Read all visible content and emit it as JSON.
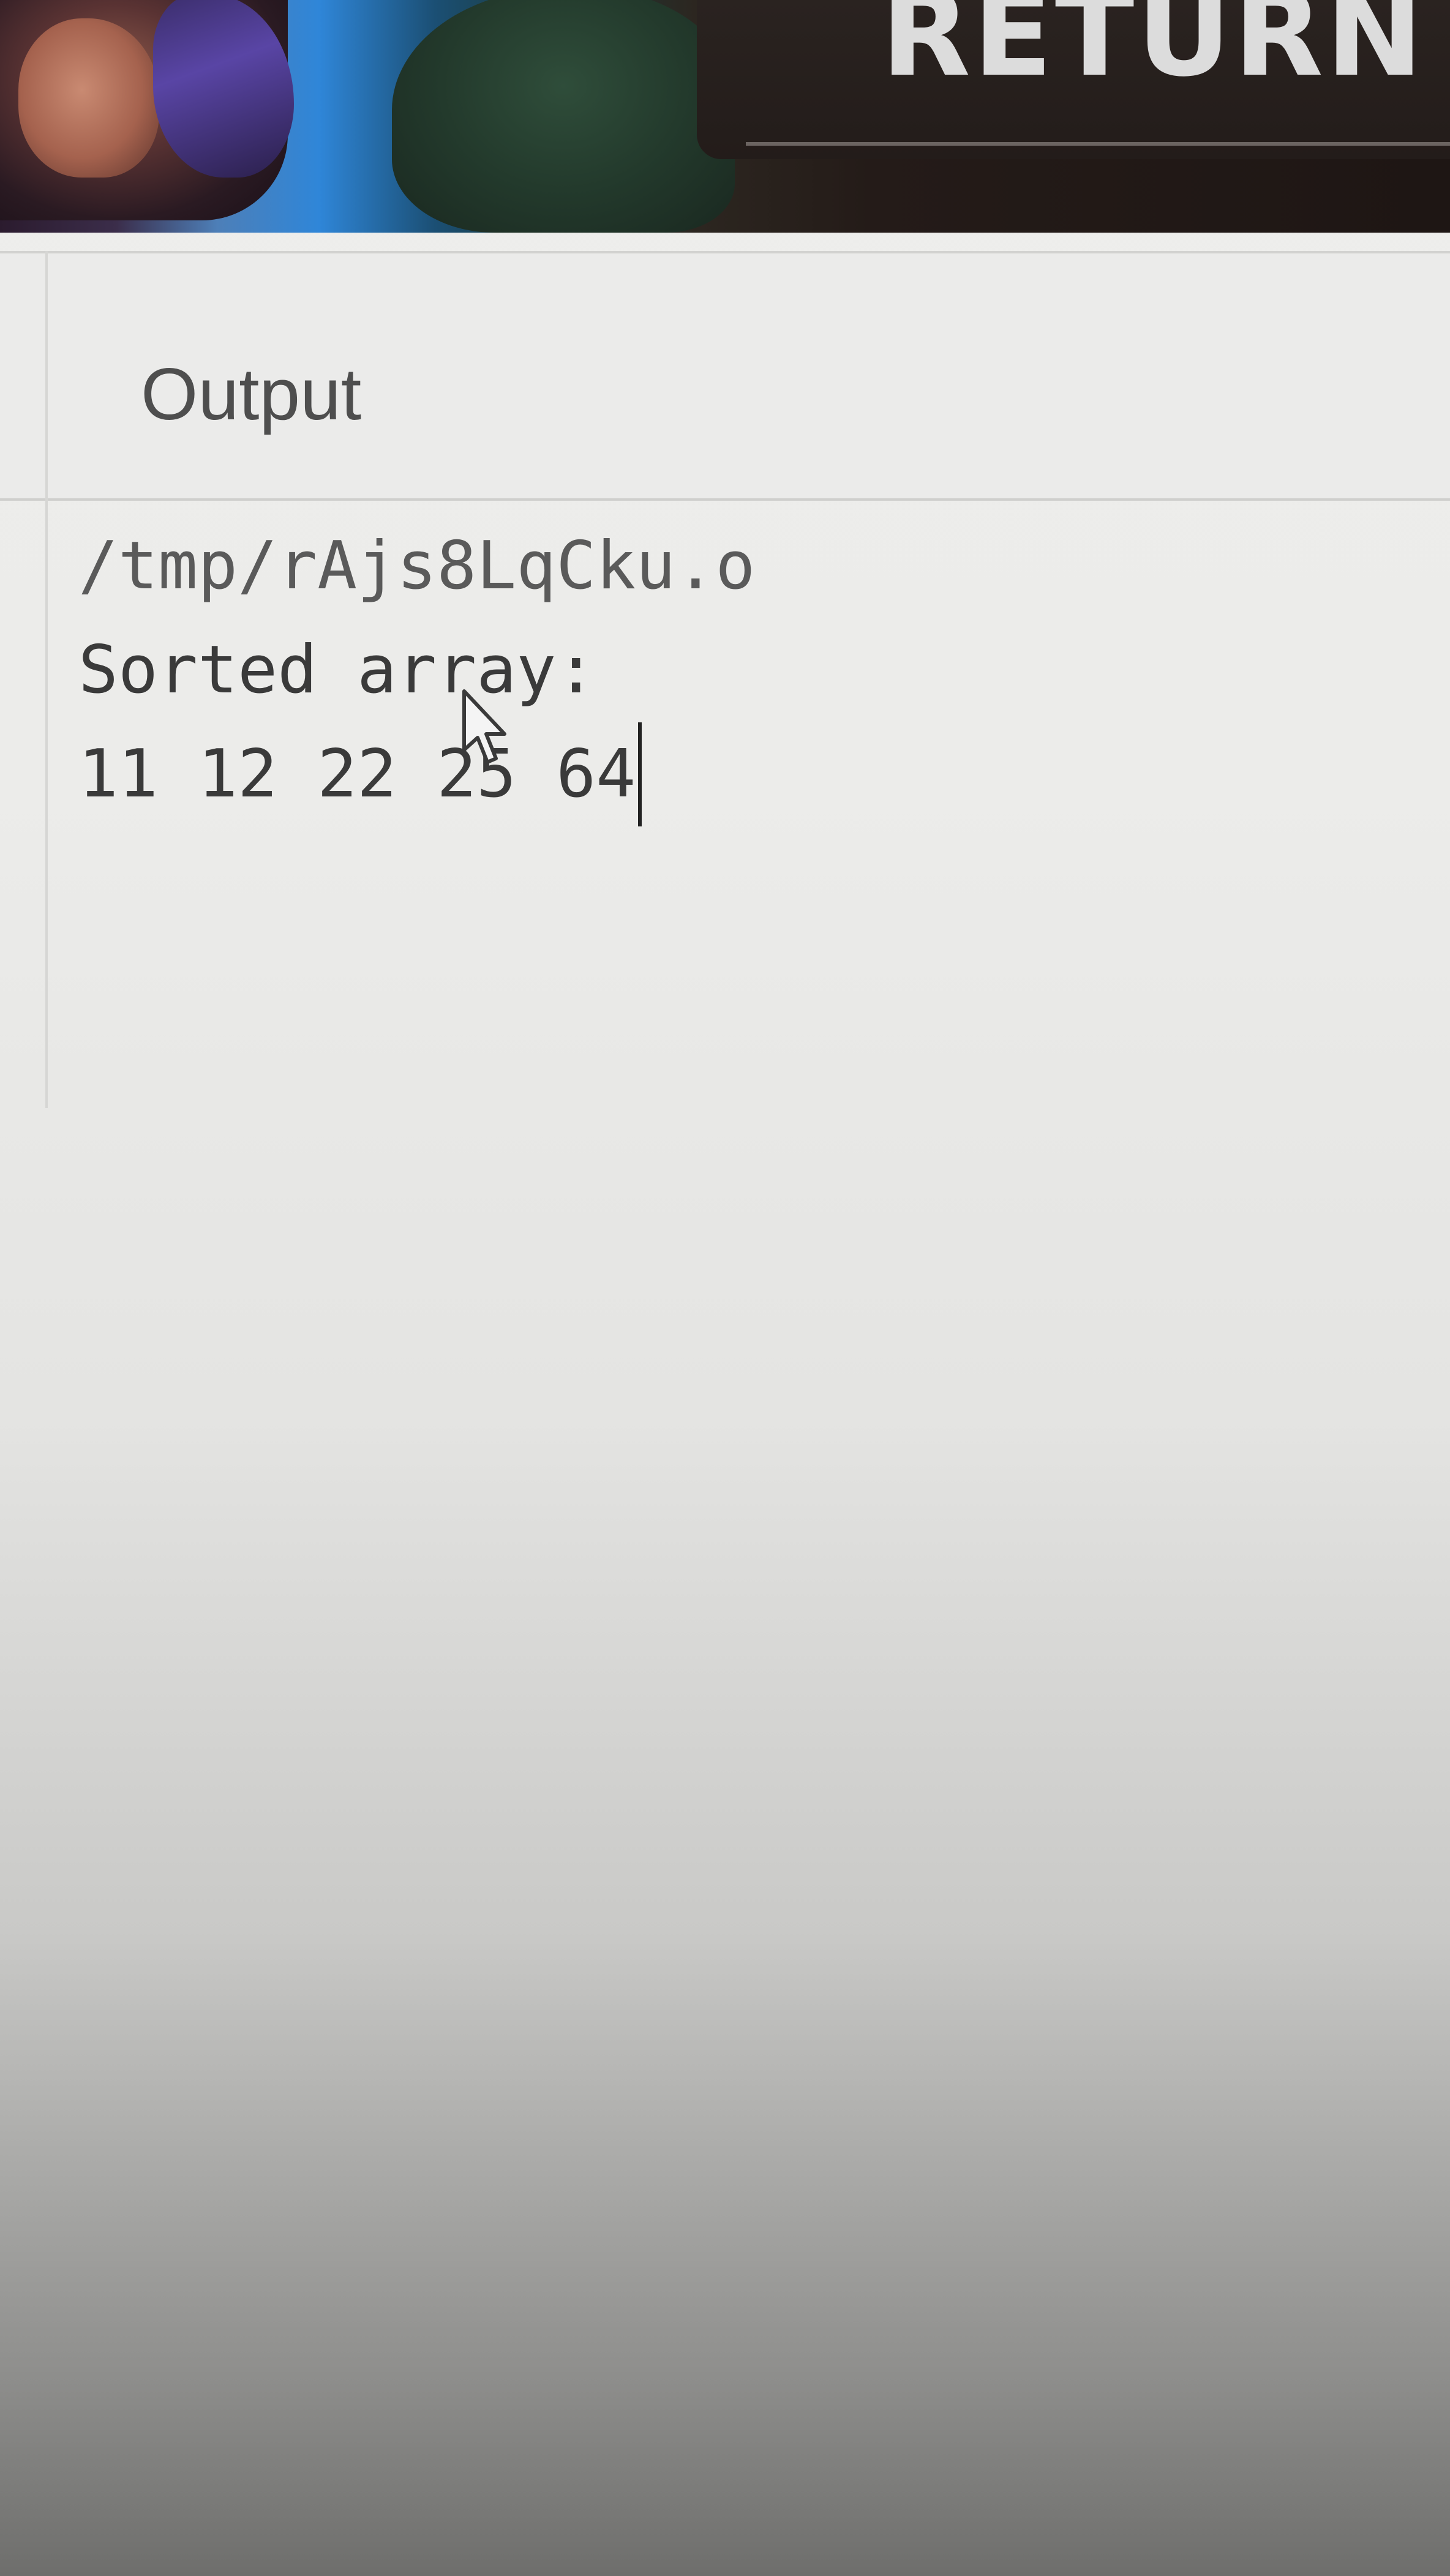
{
  "banner": {
    "return_label": "RETURN"
  },
  "output": {
    "title": "Output",
    "lines": [
      "/tmp/rAjs8LqCku.o",
      "Sorted array:",
      "11 12 22 25 64"
    ]
  },
  "icons": {
    "pointer": "mouse-pointer-icon",
    "caret": "text-caret-icon"
  }
}
